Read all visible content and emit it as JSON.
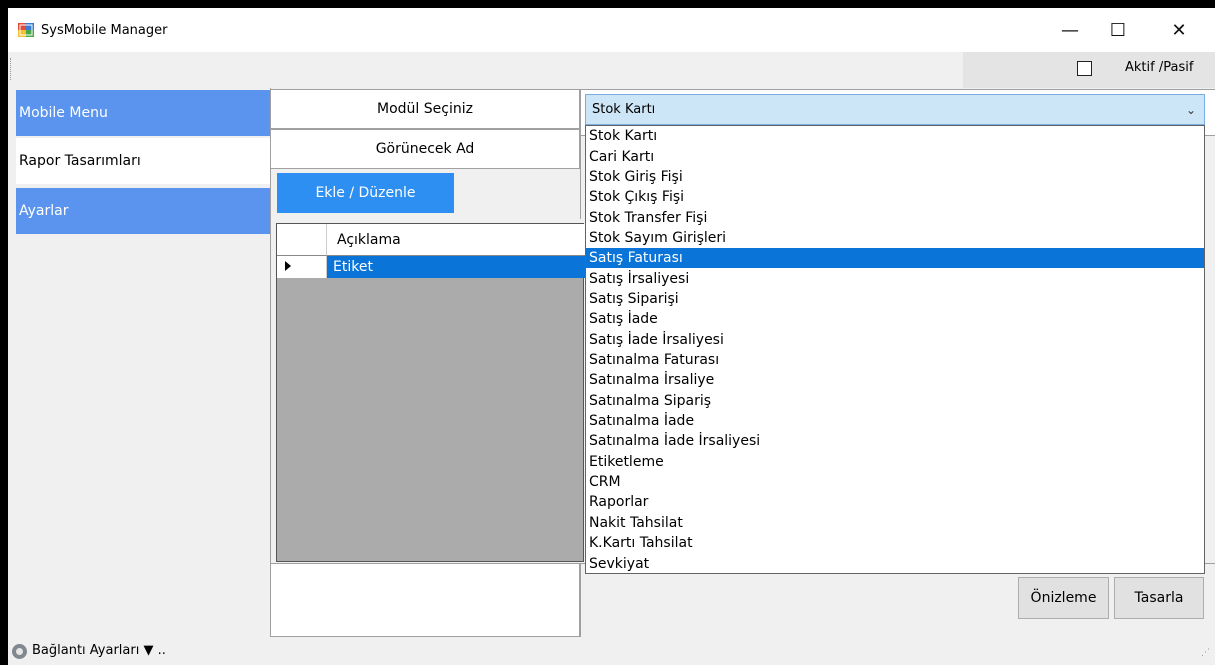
{
  "window": {
    "title": "SysMobile Manager",
    "controls": {
      "minimize": "—",
      "maximize": "☐",
      "close": "✕"
    }
  },
  "toolbar": {
    "checkbox_label": "Aktif /Pasif",
    "checkbox_checked": false
  },
  "sidebar": {
    "items": [
      {
        "label": "Mobile Menu",
        "active": true
      },
      {
        "label": "Rapor Tasarımları",
        "active": false
      },
      {
        "label": "Ayarlar",
        "active": true
      }
    ]
  },
  "form": {
    "module_label": "Modül Seçiniz",
    "display_name_label": "Görünecek Ad",
    "add_edit_button": "Ekle / Düzenle"
  },
  "grid": {
    "column_header": "Açıklama",
    "rows": [
      {
        "value": "Etiket",
        "selected": true
      }
    ]
  },
  "combo": {
    "selected_value": "Stok Kartı",
    "options": [
      "Stok Kartı",
      "Cari Kartı",
      "Stok Giriş Fişi",
      "Stok Çıkış Fişi",
      "Stok Transfer Fişi",
      "Stok Sayım Girişleri",
      "Satış Faturası",
      "Satış İrsaliyesi",
      "Satış Siparişi",
      "Satış İade",
      "Satış İade İrsaliyesi",
      "Satınalma Faturası",
      "Satınalma İrsaliye",
      "Satınalma Sipariş",
      "Satınalma İade",
      "Satınalma İade İrsaliyesi",
      "Etiketleme",
      "CRM",
      "Raporlar",
      "Nakit Tahsilat",
      "K.Kartı Tahsilat",
      "Sevkiyat"
    ],
    "highlighted_index": 6
  },
  "buttons": {
    "preview": "Önizleme",
    "design": "Tasarla"
  },
  "status": {
    "label": "Bağlantı Ayarları ▼ .."
  },
  "colors": {
    "accent": "#5a94ee",
    "button_blue": "#2e8ff2",
    "selection": "#0a74d8",
    "combo_bg": "#cde6f7"
  }
}
